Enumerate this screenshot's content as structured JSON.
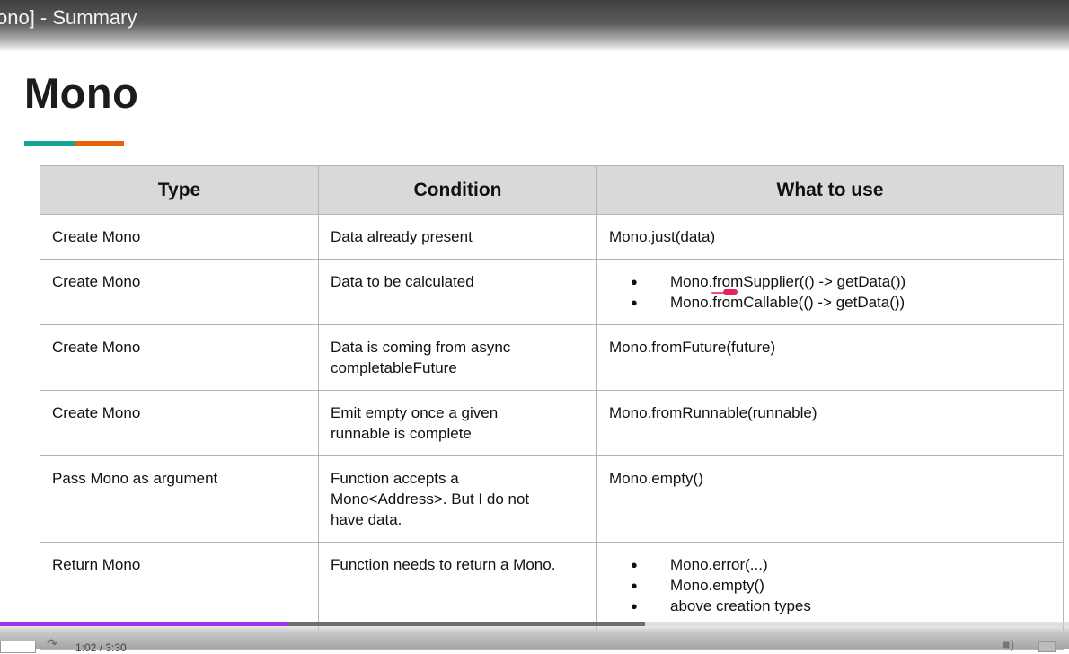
{
  "video": {
    "title": "ono] - Summary",
    "time": "1:02 / 3:30",
    "progress_played": 0.268,
    "progress_buffered": 0.603
  },
  "slide": {
    "title": "Mono",
    "accent_colors": {
      "teal": "#16a395",
      "orange": "#e8620a"
    }
  },
  "table": {
    "headers": [
      "Type",
      "Condition",
      "What to use"
    ],
    "rows": [
      {
        "type": "Create Mono",
        "condition": "Data already present",
        "use": [
          "Mono.just(data)"
        ],
        "bulleted": false
      },
      {
        "type": "Create Mono",
        "condition": "Data to be calculated",
        "use": [
          "Mono.fromSupplier(() -> getData())",
          "Mono.fromCallable(() -> getData())"
        ],
        "bulleted": true
      },
      {
        "type": "Create Mono",
        "condition": "Data is coming from async completableFuture",
        "use": [
          "Mono.fromFuture(future)"
        ],
        "bulleted": false
      },
      {
        "type": "Create Mono",
        "condition": "Emit empty once a given runnable is complete",
        "use": [
          "Mono.fromRunnable(runnable)"
        ],
        "bulleted": false
      },
      {
        "type": "Pass Mono as argument",
        "condition": "Function accepts a Mono<Address>. But I do not have data.",
        "use": [
          "Mono.empty()"
        ],
        "bulleted": false
      },
      {
        "type": "Return Mono",
        "condition": "Function needs to return a Mono.",
        "use": [
          "Mono.error(...)",
          "Mono.empty()",
          "above creation types"
        ],
        "bulleted": true
      }
    ]
  },
  "colors": {
    "header_bg": "#d9d9d9",
    "progress_played": "#a232e6",
    "progress_buffered": "#6d6d6d",
    "pen_mark": "#e2245d"
  },
  "icons": [
    "redo-icon",
    "volume-icon",
    "fullscreen-icon"
  ]
}
